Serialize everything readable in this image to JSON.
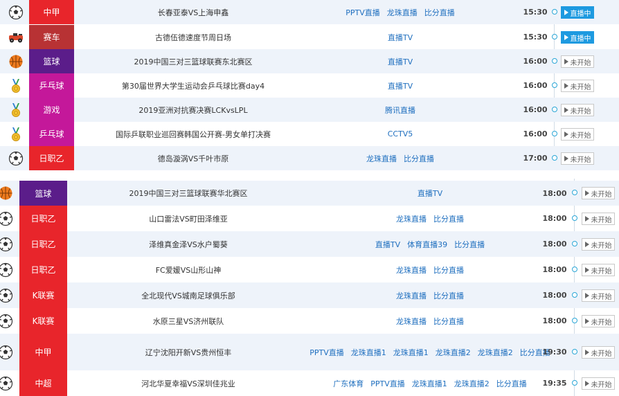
{
  "colors": {
    "accent_blue": "#1e9ae0",
    "link_blue": "#1f6fbf",
    "cat_red": "#e8252b",
    "cat_darkred": "#b83234",
    "cat_purple": "#5b1d8a",
    "cat_magenta": "#c4189a",
    "row_zebra": "#eef3fa"
  },
  "status_labels": {
    "live": "直播中",
    "not_started": "未开始"
  },
  "top_rows": [
    {
      "icon": "soccer-ball-icon",
      "category": "中甲",
      "cat_color": "#e8252b",
      "match": "长春亚泰VS上海申鑫",
      "links": [
        "PPTV直播",
        "龙珠直播",
        "比分直播"
      ],
      "time": "15:30",
      "status": "live"
    },
    {
      "icon": "racing-car-icon",
      "category": "赛车",
      "cat_color": "#b83234",
      "match": "古德伍德速度节周日场",
      "links": [
        "直播TV"
      ],
      "time": "15:30",
      "status": "live"
    },
    {
      "icon": "basketball-icon",
      "category": "篮球",
      "cat_color": "#5b1d8a",
      "match": "2019中国三对三篮球联赛东北赛区",
      "links": [
        "直播TV"
      ],
      "time": "16:00",
      "status": "not_started"
    },
    {
      "icon": "medal-icon",
      "category": "乒乓球",
      "cat_color": "#c4189a",
      "match": "第30届世界大学生运动会乒乓球比赛day4",
      "links": [
        "直播TV"
      ],
      "time": "16:00",
      "status": "not_started"
    },
    {
      "icon": "medal-icon",
      "category": "游戏",
      "cat_color": "#c4189a",
      "match": "2019亚洲对抗赛决赛LCKvsLPL",
      "links": [
        "腾讯直播"
      ],
      "time": "16:00",
      "status": "not_started"
    },
    {
      "icon": "medal-icon",
      "category": "乒乓球",
      "cat_color": "#c4189a",
      "match": "国际乒联职业巡回赛韩国公开赛-男女单打决赛",
      "links": [
        "CCTV5"
      ],
      "time": "16:00",
      "status": "not_started"
    },
    {
      "icon": "soccer-ball-icon",
      "category": "日职乙",
      "cat_color": "#e8252b",
      "match": "德岛漩涡VS千叶市原",
      "links": [
        "龙珠直播",
        "比分直播"
      ],
      "time": "17:00",
      "status": "not_started"
    }
  ],
  "bottom_rows": [
    {
      "icon": "basketball-icon",
      "category": "篮球",
      "cat_color": "#5b1d8a",
      "match": "2019中国三对三篮球联赛华北赛区",
      "links": [
        "直播TV"
      ],
      "time": "18:00",
      "status": "not_started"
    },
    {
      "icon": "soccer-ball-icon",
      "category": "日职乙",
      "cat_color": "#e8252b",
      "match": "山口雷法VS町田泽维亚",
      "links": [
        "龙珠直播",
        "比分直播"
      ],
      "time": "18:00",
      "status": "not_started"
    },
    {
      "icon": "soccer-ball-icon",
      "category": "日职乙",
      "cat_color": "#e8252b",
      "match": "泽维真金泽VS水户蜀葵",
      "links": [
        "直播TV",
        "体育直播39",
        "比分直播"
      ],
      "time": "18:00",
      "status": "not_started"
    },
    {
      "icon": "soccer-ball-icon",
      "category": "日职乙",
      "cat_color": "#e8252b",
      "match": "FC爱媛VS山形山神",
      "links": [
        "龙珠直播",
        "比分直播"
      ],
      "time": "18:00",
      "status": "not_started"
    },
    {
      "icon": "soccer-ball-icon",
      "category": "K联赛",
      "cat_color": "#e8252b",
      "match": "全北现代VS城南足球俱乐部",
      "links": [
        "龙珠直播",
        "比分直播"
      ],
      "time": "18:00",
      "status": "not_started"
    },
    {
      "icon": "soccer-ball-icon",
      "category": "K联赛",
      "cat_color": "#e8252b",
      "match": "水原三星VS济州联队",
      "links": [
        "龙珠直播",
        "比分直播"
      ],
      "time": "18:00",
      "status": "not_started"
    },
    {
      "icon": "soccer-ball-icon",
      "category": "中甲",
      "cat_color": "#e8252b",
      "match": "辽宁沈阳开新VS贵州恒丰",
      "links": [
        "PPTV直播",
        "龙珠直播1",
        "龙珠直播1",
        "龙珠直播2",
        "龙珠直播2",
        "比分直播"
      ],
      "time": "19:30",
      "status": "not_started"
    },
    {
      "icon": "soccer-ball-icon",
      "category": "中超",
      "cat_color": "#e8252b",
      "match": "河北华夏幸福VS深圳佳兆业",
      "links": [
        "广东体育",
        "PPTV直播",
        "龙珠直播1",
        "龙珠直播2",
        "比分直播"
      ],
      "time": "19:35",
      "status": "not_started"
    }
  ]
}
